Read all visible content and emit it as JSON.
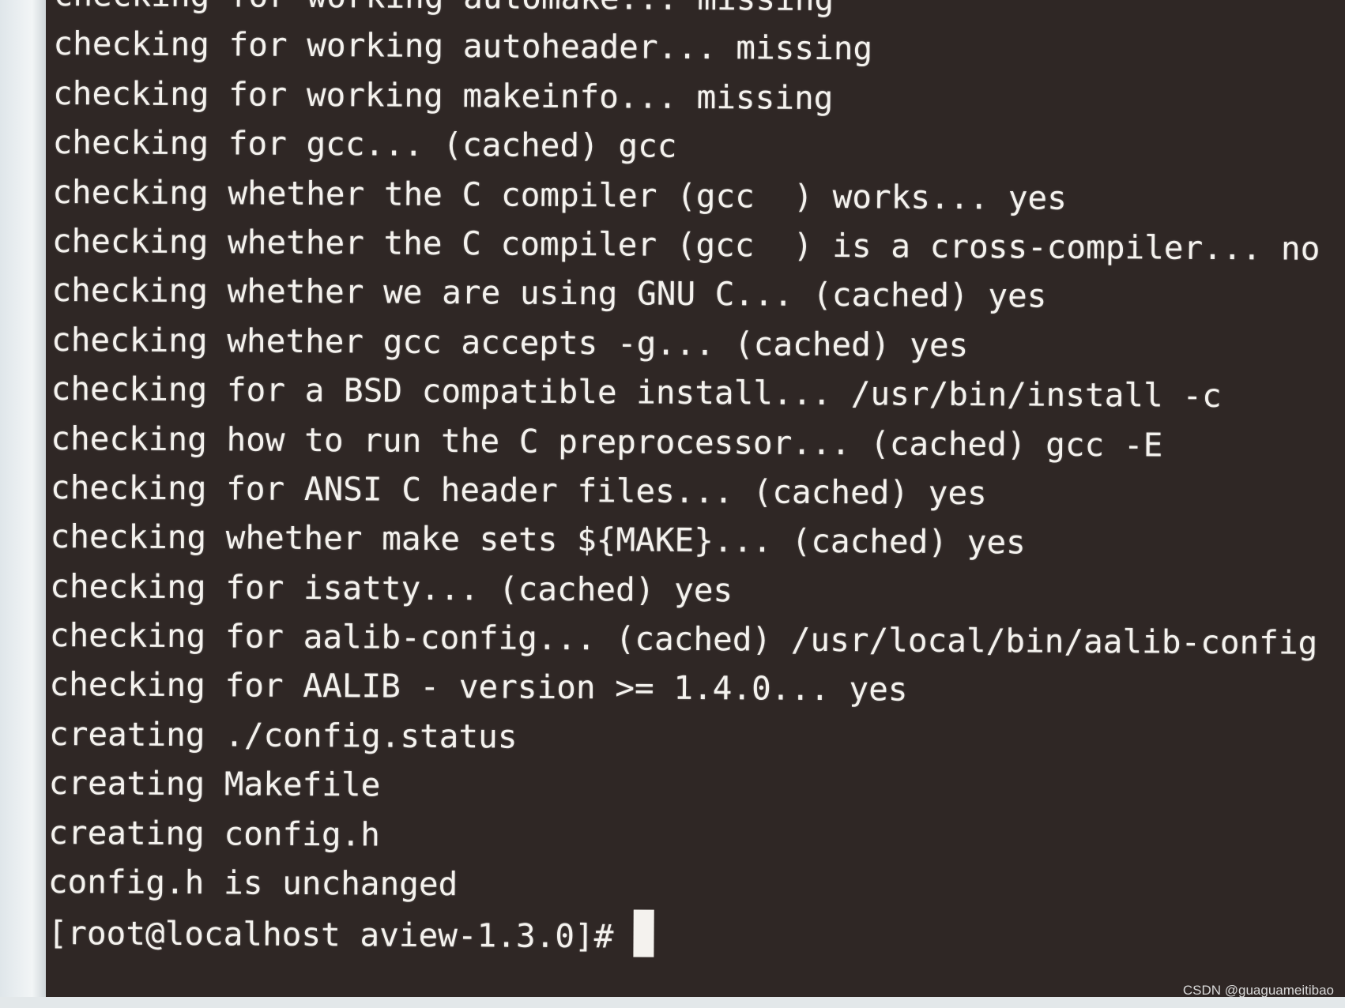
{
  "terminal": {
    "lines": [
      "checking for working automake... missing",
      "checking for working autoheader... missing",
      "checking for working makeinfo... missing",
      "checking for gcc... (cached) gcc",
      "checking whether the C compiler (gcc  ) works... yes",
      "checking whether the C compiler (gcc  ) is a cross-compiler... no",
      "checking whether we are using GNU C... (cached) yes",
      "checking whether gcc accepts -g... (cached) yes",
      "checking for a BSD compatible install... /usr/bin/install -c",
      "checking how to run the C preprocessor... (cached) gcc -E",
      "checking for ANSI C header files... (cached) yes",
      "checking whether make sets ${MAKE}... (cached) yes",
      "checking for isatty... (cached) yes",
      "checking for aalib-config... (cached) /usr/local/bin/aalib-config",
      "checking for AALIB - version >= 1.4.0... yes",
      "creating ./config.status",
      "creating Makefile",
      "creating config.h",
      "config.h is unchanged"
    ],
    "prompt": "[root@localhost aview-1.3.0]# ",
    "background": "#2f2725",
    "foreground": "#f4f2ee"
  },
  "watermark": "CSDN @guaguameitibao"
}
